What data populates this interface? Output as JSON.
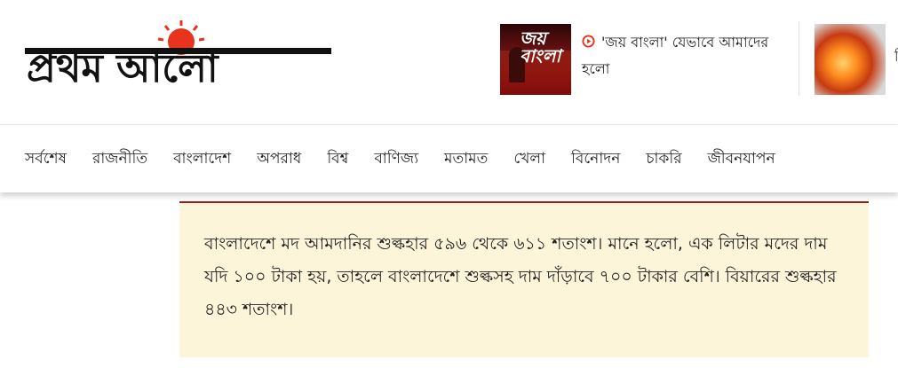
{
  "brand": {
    "logo_text": "প্রথম আলো"
  },
  "featured": [
    {
      "thumb_title": "জয় বাংলা",
      "headline": "'জয় বাংলা' যেভাবে আমাদের হলো",
      "has_video": true
    },
    {
      "clipped_text": "বি"
    }
  ],
  "nav": {
    "items": [
      "সর্বশেষ",
      "রাজনীতি",
      "বাংলাদেশ",
      "অপরাধ",
      "বিশ্ব",
      "বাণিজ্য",
      "মতামত",
      "খেলা",
      "বিনোদন",
      "চাকরি",
      "জীবনযাপন"
    ]
  },
  "article": {
    "highlight": "বাংলাদেশে মদ আমদানির শুল্কহার ৫৯৬ থেকে ৬১১ শতাংশ। মানে হলো, এক লিটার মদের দাম যদি ১০০ টাকা হয়, তাহলে বাংলাদেশে শুল্কসহ দাম দাঁড়াবে ৭০০ টাকার বেশি। বিয়ারের শুল্কহার ৪৪৩ শতাংশ।"
  },
  "colors": {
    "brand_red": "#e8341c",
    "accent_border": "#9e1b1b",
    "highlight_bg": "#fdf5da"
  }
}
